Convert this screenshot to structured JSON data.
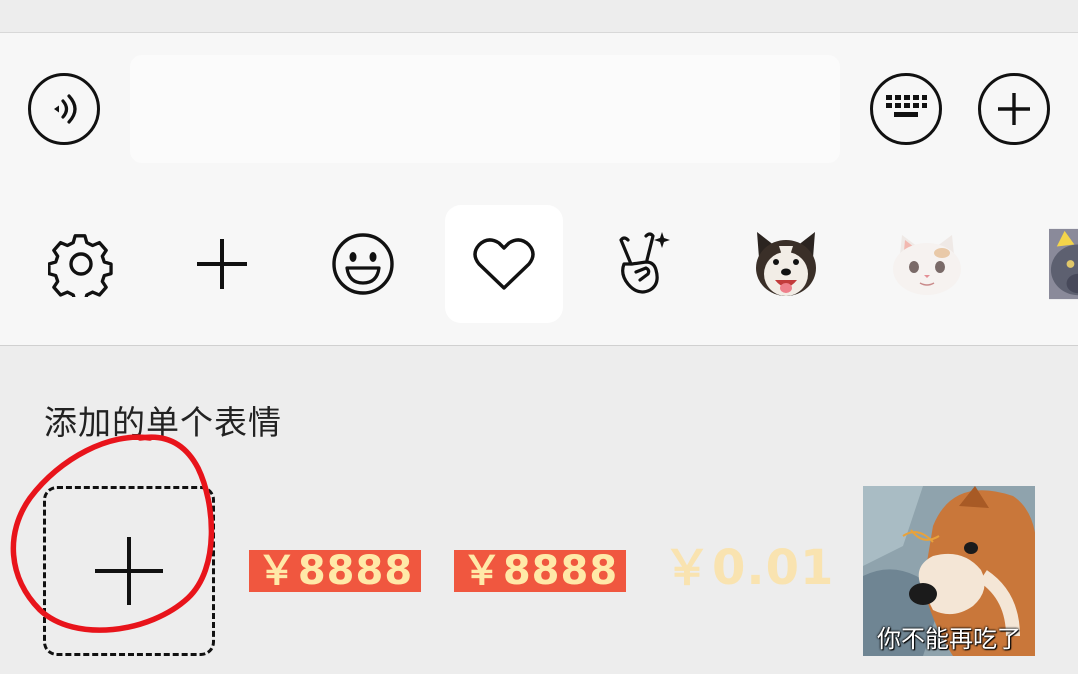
{
  "input_bar": {
    "voice_icon": "voice-wave-icon",
    "text_value": "",
    "keyboard_icon": "keyboard-icon",
    "plus_icon": "plus-circle-icon"
  },
  "emoji_tabs": [
    {
      "name": "settings",
      "icon": "gear-icon"
    },
    {
      "name": "add",
      "icon": "plus-icon"
    },
    {
      "name": "emoji",
      "icon": "smiley-icon"
    },
    {
      "name": "favorites",
      "icon": "heart-icon",
      "active": true
    },
    {
      "name": "gesture",
      "icon": "victory-hand-icon"
    },
    {
      "name": "sticker-pack-dog",
      "icon": "husky-dog-image"
    },
    {
      "name": "sticker-pack-cat",
      "icon": "white-cat-image"
    },
    {
      "name": "sticker-pack-gray-cat",
      "icon": "gray-cat-image"
    }
  ],
  "panel": {
    "section_title": "添加的单个表情",
    "stickers": [
      {
        "type": "add",
        "icon": "plus-icon"
      },
      {
        "type": "price",
        "text": "￥8888"
      },
      {
        "type": "price",
        "text": "￥8888"
      },
      {
        "type": "price-faint",
        "text": "￥0.01"
      },
      {
        "type": "image",
        "caption": "你不能再吃了",
        "icon": "shiba-dog-image"
      }
    ]
  },
  "colors": {
    "background": "#ededed",
    "bar_background": "#f7f7f7",
    "active_tab": "#ffffff",
    "price_tag": "#f0573f",
    "price_text": "#ffe9a8",
    "annotation_circle": "#e8141b"
  }
}
